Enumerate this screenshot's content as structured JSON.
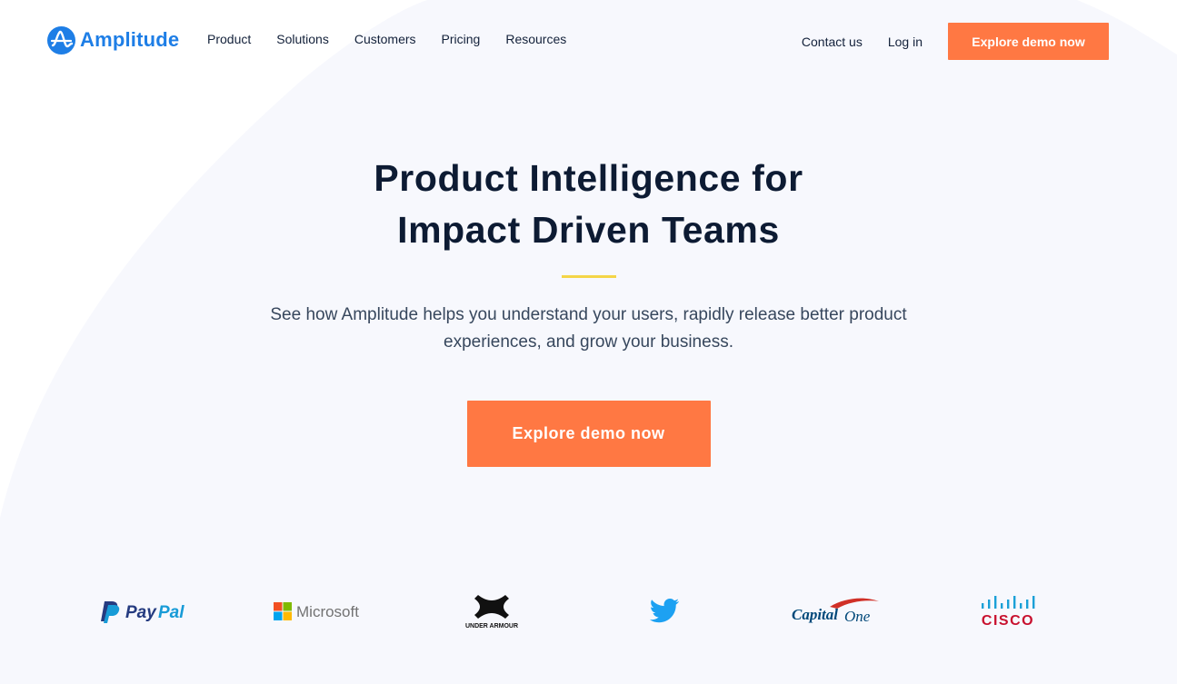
{
  "colors": {
    "brand_blue": "#1e7ee6",
    "cta_orange": "#ff7843",
    "accent_yellow": "#f4d547",
    "background_tint": "#f7f8fd",
    "heading": "#0d1b33"
  },
  "logo": {
    "name": "Amplitude",
    "icon": "amplitude-logo-icon"
  },
  "nav": {
    "links": [
      "Product",
      "Solutions",
      "Customers",
      "Pricing",
      "Resources"
    ],
    "contact": "Contact us",
    "login": "Log in",
    "cta": "Explore demo now"
  },
  "hero": {
    "title_line1": "Product Intelligence for",
    "title_line2": "Impact Driven Teams",
    "subtitle": "See how Amplitude helps you understand your users, rapidly release better product experiences, and grow your business.",
    "cta": "Explore demo now"
  },
  "customers": [
    {
      "name": "PayPal",
      "icon": "paypal-logo-icon"
    },
    {
      "name": "Microsoft",
      "icon": "microsoft-logo-icon"
    },
    {
      "name": "UNDER ARMOUR",
      "icon": "under-armour-logo-icon"
    },
    {
      "name": "Twitter",
      "icon": "twitter-bird-icon"
    },
    {
      "name": "Capital One",
      "icon": "capital-one-logo-icon"
    },
    {
      "name": "CISCO",
      "icon": "cisco-logo-icon"
    }
  ]
}
